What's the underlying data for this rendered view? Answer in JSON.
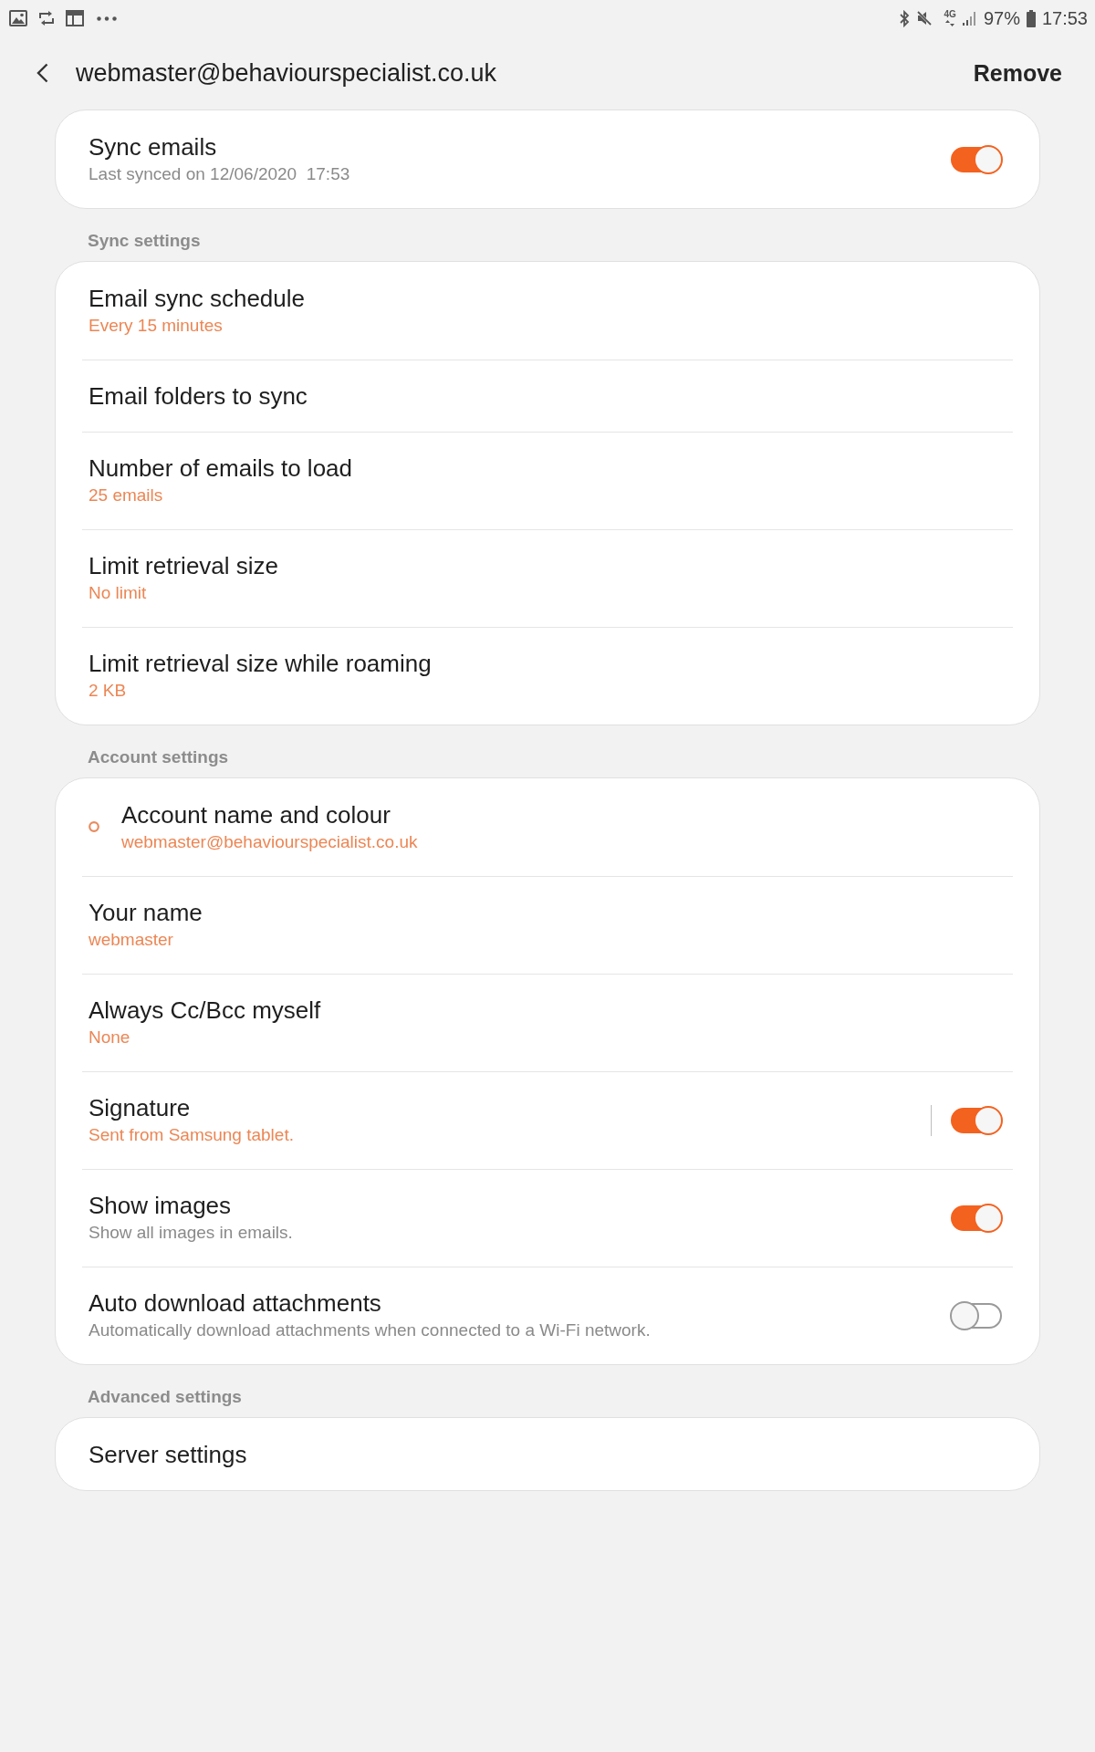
{
  "status_bar": {
    "network": "4G",
    "battery": "97%",
    "time": "17:53"
  },
  "header": {
    "title": "webmaster@behaviourspecialist.co.uk",
    "action": "Remove"
  },
  "groups": [
    {
      "items": [
        {
          "kind": "toggle",
          "title": "Sync emails",
          "description": "Last synced on 12/06/2020  17:53",
          "on": true
        }
      ]
    },
    {
      "header": "Sync settings",
      "items": [
        {
          "kind": "plain",
          "title": "Email sync schedule",
          "value": "Every 15 minutes"
        },
        {
          "kind": "plain",
          "title": "Email folders to sync"
        },
        {
          "kind": "plain",
          "title": "Number of emails to load",
          "value": "25 emails"
        },
        {
          "kind": "plain",
          "title": "Limit retrieval size",
          "value": "No limit"
        },
        {
          "kind": "plain",
          "title": "Limit retrieval size while roaming",
          "value": "2 KB"
        }
      ]
    },
    {
      "header": "Account settings",
      "items": [
        {
          "kind": "plain",
          "title": "Account name and colour",
          "value": "webmaster@behaviourspecialist.co.uk",
          "color": "#e98b5f"
        },
        {
          "kind": "plain",
          "title": "Your name",
          "value": "webmaster"
        },
        {
          "kind": "plain",
          "title": "Always Cc/Bcc myself",
          "value": "None"
        },
        {
          "kind": "split-toggle",
          "title": "Signature",
          "value": "Sent from Samsung tablet.",
          "on": true
        },
        {
          "kind": "toggle",
          "title": "Show images",
          "description": "Show all images in emails.",
          "on": true
        },
        {
          "kind": "toggle",
          "title": "Auto download attachments",
          "description": "Automatically download attachments when connected to a Wi-Fi network.",
          "on": false
        }
      ]
    },
    {
      "header": "Advanced settings",
      "items": [
        {
          "kind": "plain",
          "title": "Server settings"
        }
      ]
    }
  ]
}
